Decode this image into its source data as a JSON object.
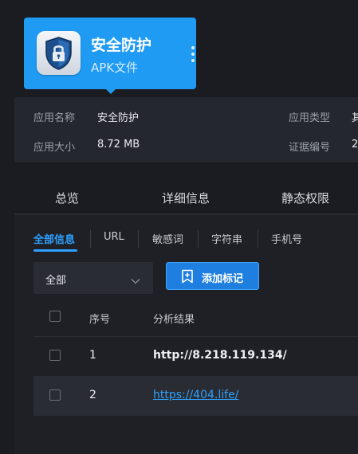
{
  "app": {
    "name": "安全防护",
    "type": "APK文件",
    "icon": "shield-lock-icon"
  },
  "info": {
    "app_name_label": "应用名称",
    "app_name_value": "安全防护",
    "app_category_label": "应用类型",
    "app_category_value": "其",
    "app_size_label": "应用大小",
    "app_size_value": "8.72 MB",
    "cert_no_label": "证据编号",
    "cert_no_value": "2"
  },
  "tabs": [
    "总览",
    "详细信息",
    "静态权限"
  ],
  "subtabs": [
    "全部信息",
    "URL",
    "敏感词",
    "字符串",
    "手机号"
  ],
  "filter": {
    "value": "全部"
  },
  "add_tag_button": {
    "label": "添加标记",
    "icon": "bookmark-plus-icon"
  },
  "table": {
    "headers": {
      "index": "序号",
      "result": "分析结果"
    },
    "rows": [
      {
        "index": "1",
        "result": "http://8.218.119.134/",
        "is_link": false
      },
      {
        "index": "2",
        "result": "https://404.life/",
        "is_link": true
      }
    ]
  },
  "colors": {
    "accent": "#1f9bf3",
    "button": "#1f7fe0",
    "link": "#2ea1ff",
    "background": "#1b1c21"
  }
}
